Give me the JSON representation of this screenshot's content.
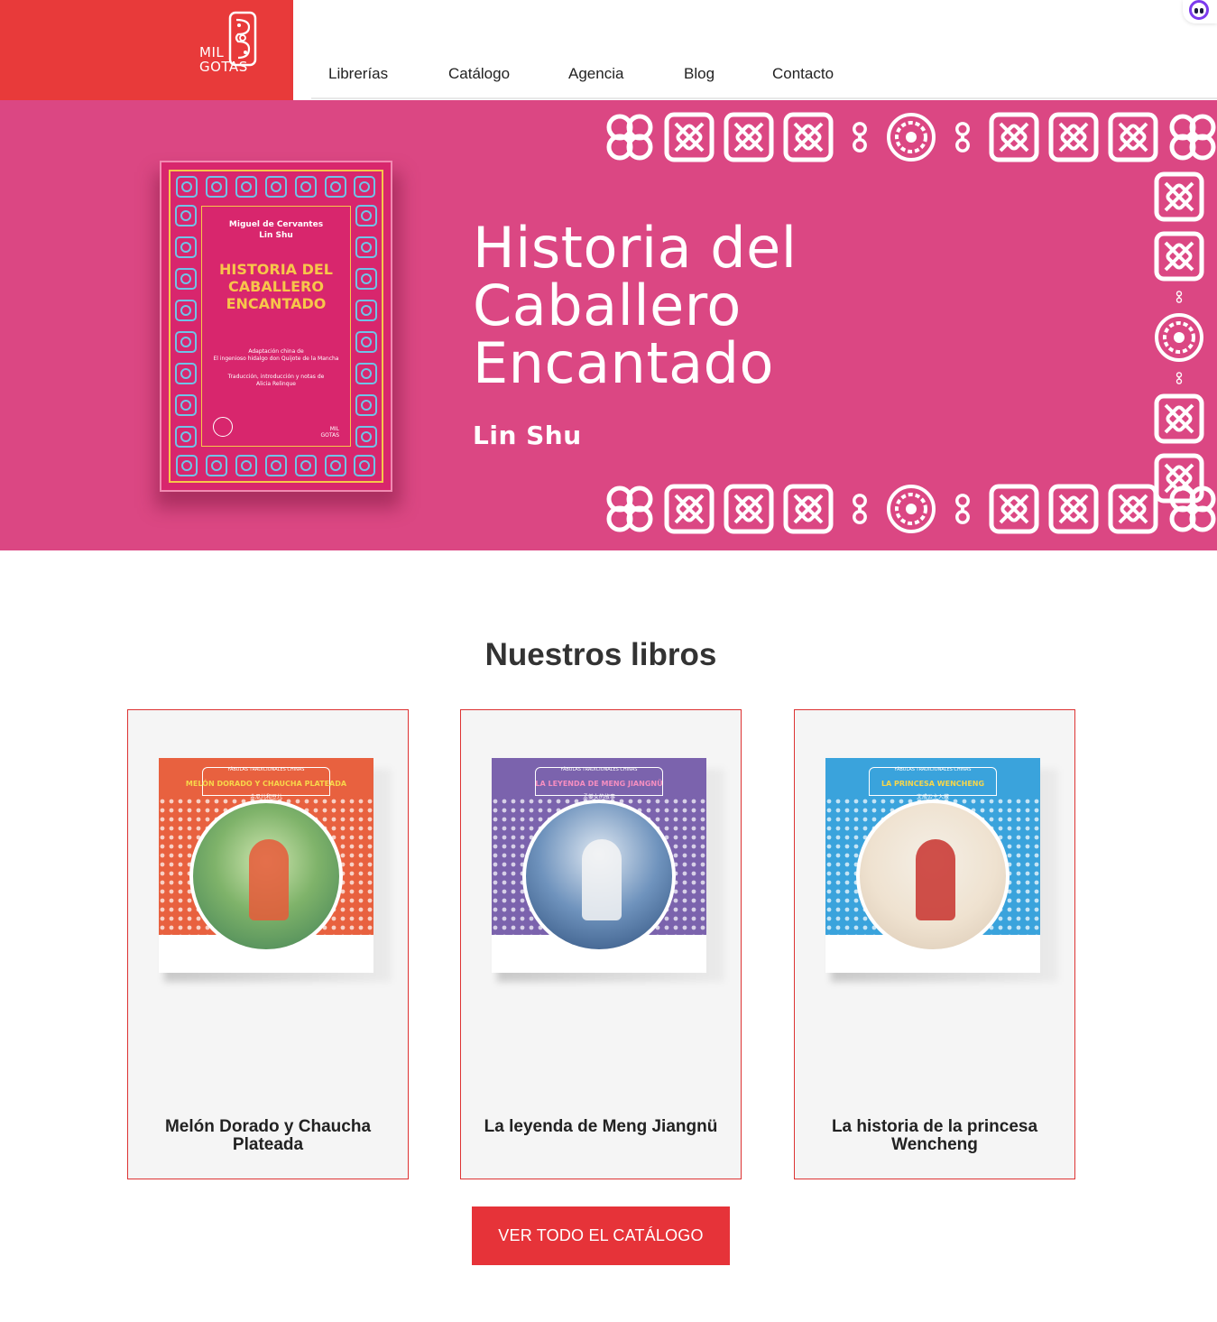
{
  "logo": {
    "line1": "MIL",
    "line2": "GOTAS"
  },
  "nav": {
    "items": [
      "Librerías",
      "Catálogo",
      "Agencia",
      "Blog",
      "Contacto"
    ]
  },
  "hero": {
    "title_lines": [
      "Historia del",
      "Caballero",
      "Encantado"
    ],
    "author": "Lin Shu",
    "background": "#db4783",
    "cover": {
      "authors": [
        "Miguel de Cervantes",
        "Lin Shu"
      ],
      "title_lines": [
        "HISTORIA DEL",
        "CABALLERO",
        "ENCANTADO"
      ],
      "note_lines": [
        "Adaptación china de",
        "El ingenioso hidalgo don Quijote de la Mancha"
      ],
      "credit_lines": [
        "Traducción, introducción y notas de",
        "Alicia Relinque"
      ],
      "brand": [
        "MIL",
        "GOTAS"
      ]
    }
  },
  "section": {
    "title": "Nuestros libros"
  },
  "books": [
    {
      "title": "Melón Dorado y Chaucha Plateada",
      "cover_tag": "FÁBULAS TRADICIONALES CHINAS",
      "cover_title": "MELÓN DORADO Y CHAUCHA PLATEADA",
      "cover_cn": "金瓜儿和豆儿",
      "color": "#e8613f",
      "title_color": "#f7d64a"
    },
    {
      "title": "La leyenda de Meng Jiangnü",
      "cover_tag": "FÁBULAS TRADICIONALES CHINAS",
      "cover_title": "LA LEYENDA DE MENG JIANGNÜ",
      "cover_cn": "孟姜女的故事",
      "color": "#7b63ad",
      "title_color": "#f58ec0"
    },
    {
      "title": "La historia de la princesa Wencheng",
      "cover_tag": "FÁBULAS TRADICIONALES CHINAS",
      "cover_title": "LA PRINCESA WENCHENG",
      "cover_cn": "文成公主入藏",
      "color": "#3aa3dc",
      "title_color": "#f7d64a"
    }
  ],
  "cta": {
    "label": "VER TODO EL CATÁLOGO"
  },
  "colors": {
    "brand_red": "#e83a3a",
    "hero_pink": "#db4783",
    "cta_red": "#e63339"
  }
}
